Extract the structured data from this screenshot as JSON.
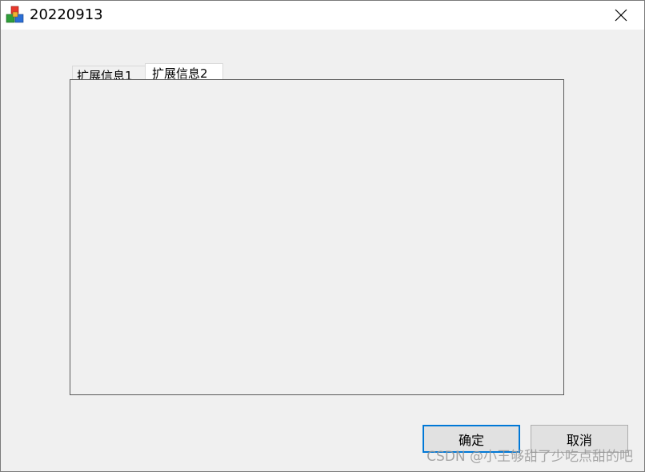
{
  "window": {
    "title": "20220913",
    "icon": "app-cubes-icon",
    "close_icon": "close-icon"
  },
  "tabs": [
    {
      "label": "扩展信息1",
      "selected": false
    },
    {
      "label": "扩展信息2",
      "selected": true
    }
  ],
  "buttons": {
    "ok_label": "确定",
    "cancel_label": "取消"
  },
  "watermark": "CSDN @小王够甜了少吃点甜的吧",
  "colors": {
    "accent": "#0078d7",
    "background": "#f0f0f0",
    "titlebar": "#ffffff"
  }
}
